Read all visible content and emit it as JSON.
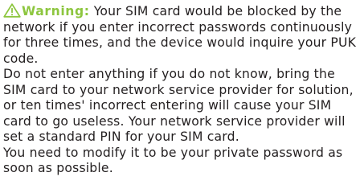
{
  "warning": {
    "icon": "warning-triangle-icon",
    "accent_color": "#8dc63f",
    "label": "Warning:",
    "lead": " Your SIM card would be blocked by the network if you enter incorrect passwords continuously for three times, and the device would inquire your PUK code.",
    "para2": "Do not enter anything if you do not know, bring the SIM card to your network service provider for solution, or ten times' incorrect entering will cause your SIM card to go useless. Your network service provider will set a standard PIN for your SIM card.",
    "para3": "You need to modify it to be your private password as soon as possible."
  },
  "text_color": "#231f20"
}
